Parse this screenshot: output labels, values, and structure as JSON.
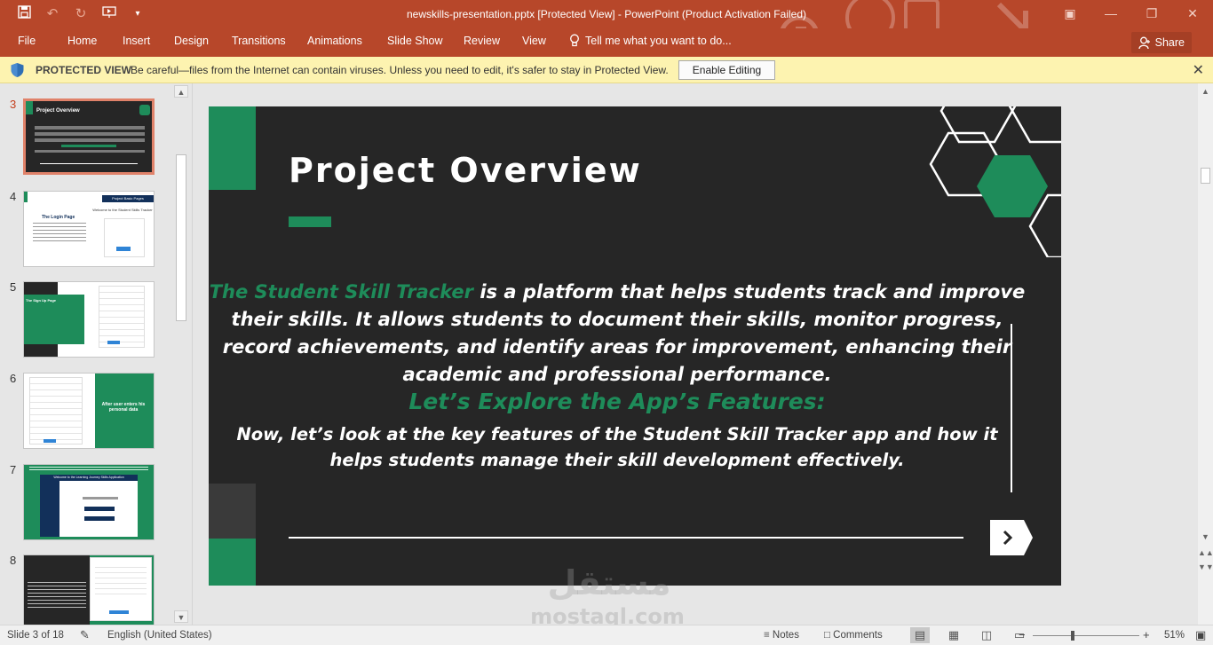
{
  "window": {
    "title": "newskills-presentation.pptx [Protected View] - PowerPoint (Product Activation Failed)",
    "accent": "#b7472a"
  },
  "qat": {
    "save_icon": "save-icon",
    "undo_icon": "undo-icon",
    "redo_icon": "redo-icon",
    "present_icon": "present-from-beginning-icon",
    "customize_icon": "customize-qat-icon"
  },
  "window_controls": {
    "ribbon_display_icon": "ribbon-display-options-icon",
    "minimize_icon": "minimize-icon",
    "restore_icon": "restore-icon",
    "close_icon": "close-icon"
  },
  "ribbon": {
    "tabs": [
      "File",
      "Home",
      "Insert",
      "Design",
      "Transitions",
      "Animations",
      "Slide Show",
      "Review",
      "View"
    ],
    "tell_me": "Tell me what you want to do...",
    "share": "Share"
  },
  "protected_view": {
    "label": "PROTECTED VIEW",
    "message": "Be careful—files from the Internet can contain viruses. Unless you need to edit, it's safer to stay in Protected View.",
    "button": "Enable Editing"
  },
  "thumbnails": {
    "numbers": [
      "3",
      "4",
      "5",
      "6",
      "7",
      "8"
    ],
    "selected": "3"
  },
  "slide": {
    "title": "Project Overview",
    "body_highlight": "The Student Skill Tracker",
    "body_rest": " is a platform that helps students track and improve their skills. It allows students to document their skills, monitor progress, record achievements, and identify areas for improvement, enhancing their academic and professional performance.",
    "subheading": "Let’s Explore the App’s Features:",
    "closing": "Now, let’s look at the key features of the Student Skill Tracker app and how it helps students manage their skill development effectively.",
    "green": "#1e8c5a",
    "background": "#262626"
  },
  "thumb_text": {
    "t3_title": "Project Overview",
    "t4_heading": "Project Basic Pages",
    "t4_welcome": "Welcome to the Student Skills Tracker",
    "t4_login": "The Login Page",
    "t5_heading": "The Sign Up Page",
    "t6_overlay": "After user enters his personal data",
    "t7_welcome": "Welcome to the Learning Journey Skills Application"
  },
  "status": {
    "slide_info": "Slide 3 of 18",
    "language": "English (United States)",
    "notes": "Notes",
    "comments": "Comments",
    "zoom": "51%"
  },
  "watermark": {
    "arabic": "مستقل",
    "latin": "mostaql.com"
  }
}
